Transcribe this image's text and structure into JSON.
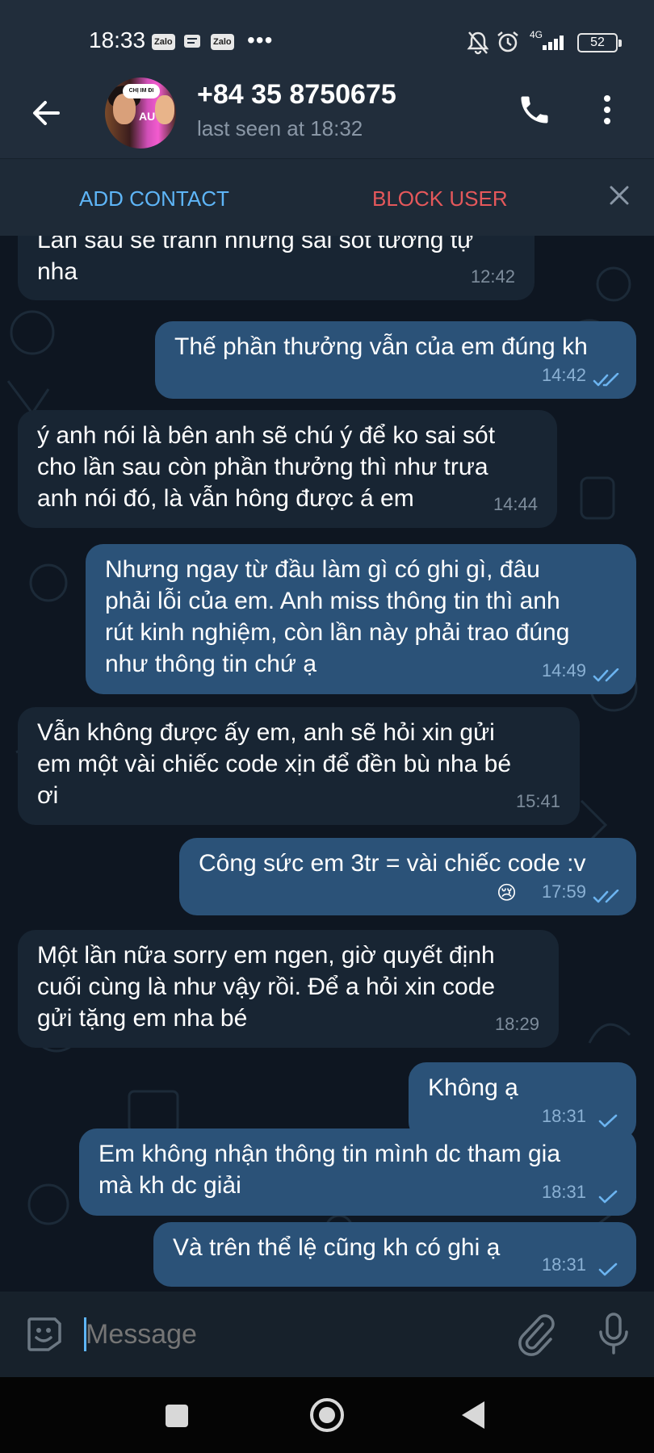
{
  "status_bar": {
    "time": "18:33",
    "app_icons": [
      "Zalo",
      "Zalo"
    ],
    "more": "•••",
    "network": "4G",
    "battery": "52"
  },
  "header": {
    "contact_name": "+84 35 8750675",
    "last_seen": "last seen at 18:32",
    "avatar_badge": "CHỊ IM ĐI",
    "avatar_text": "AU"
  },
  "actions": {
    "add_contact": "ADD CONTACT",
    "block_user": "BLOCK USER"
  },
  "messages": [
    {
      "direction": "in",
      "lines": [
        "Lần sau sẽ tránh những sai sót tương tự",
        "nha"
      ],
      "time": "12:42"
    },
    {
      "direction": "out",
      "lines": [
        "Thế phần thưởng vẫn của em đúng kh"
      ],
      "time": "14:42",
      "read": true
    },
    {
      "direction": "in",
      "lines": [
        "ý anh nói là bên anh sẽ chú ý để ko sai sót",
        "cho lần sau còn phần thưởng thì như trưa",
        "anh nói đó, là vẫn hông được á em"
      ],
      "time": "14:44"
    },
    {
      "direction": "out",
      "lines": [
        "Nhưng ngay từ đầu làm gì có ghi gì, đâu",
        "phải lỗi của em. Anh miss thông tin thì anh",
        "rút kinh nghiệm, còn lần này phải trao đúng",
        "như thông tin chứ ạ"
      ],
      "time": "14:49",
      "read": true
    },
    {
      "direction": "in",
      "lines": [
        "Vẫn không được ấy em, anh sẽ hỏi xin gửi",
        "em một vài chiếc code xịn để đền bù nha bé",
        "ơi"
      ],
      "time": "15:41"
    },
    {
      "direction": "out",
      "lines": [
        "Công sức em 3tr = vài chiếc code :v"
      ],
      "time": "17:59",
      "read": true,
      "reaction": "😢"
    },
    {
      "direction": "in",
      "lines": [
        "Một lần nữa sorry em ngen, giờ quyết định",
        "cuối cùng là như vậy rồi. Để a hỏi xin code",
        "gửi tặng em nha bé"
      ],
      "time": "18:29"
    },
    {
      "direction": "out",
      "lines": [
        "Không ạ"
      ],
      "time": "18:31",
      "read": false
    },
    {
      "direction": "out",
      "lines": [
        "Em không nhận thông tin mình  dc tham gia",
        "mà kh dc giải"
      ],
      "time": "18:31",
      "read": false
    },
    {
      "direction": "out",
      "lines": [
        "Và trên thể lệ cũng kh có ghi ạ"
      ],
      "time": "18:31",
      "read": false
    }
  ],
  "composer": {
    "placeholder": "Message"
  },
  "colors": {
    "incoming_bubble": "#182533",
    "outgoing_bubble": "#2b5278",
    "accent": "#5eb5f7",
    "danger": "#e5585b"
  }
}
